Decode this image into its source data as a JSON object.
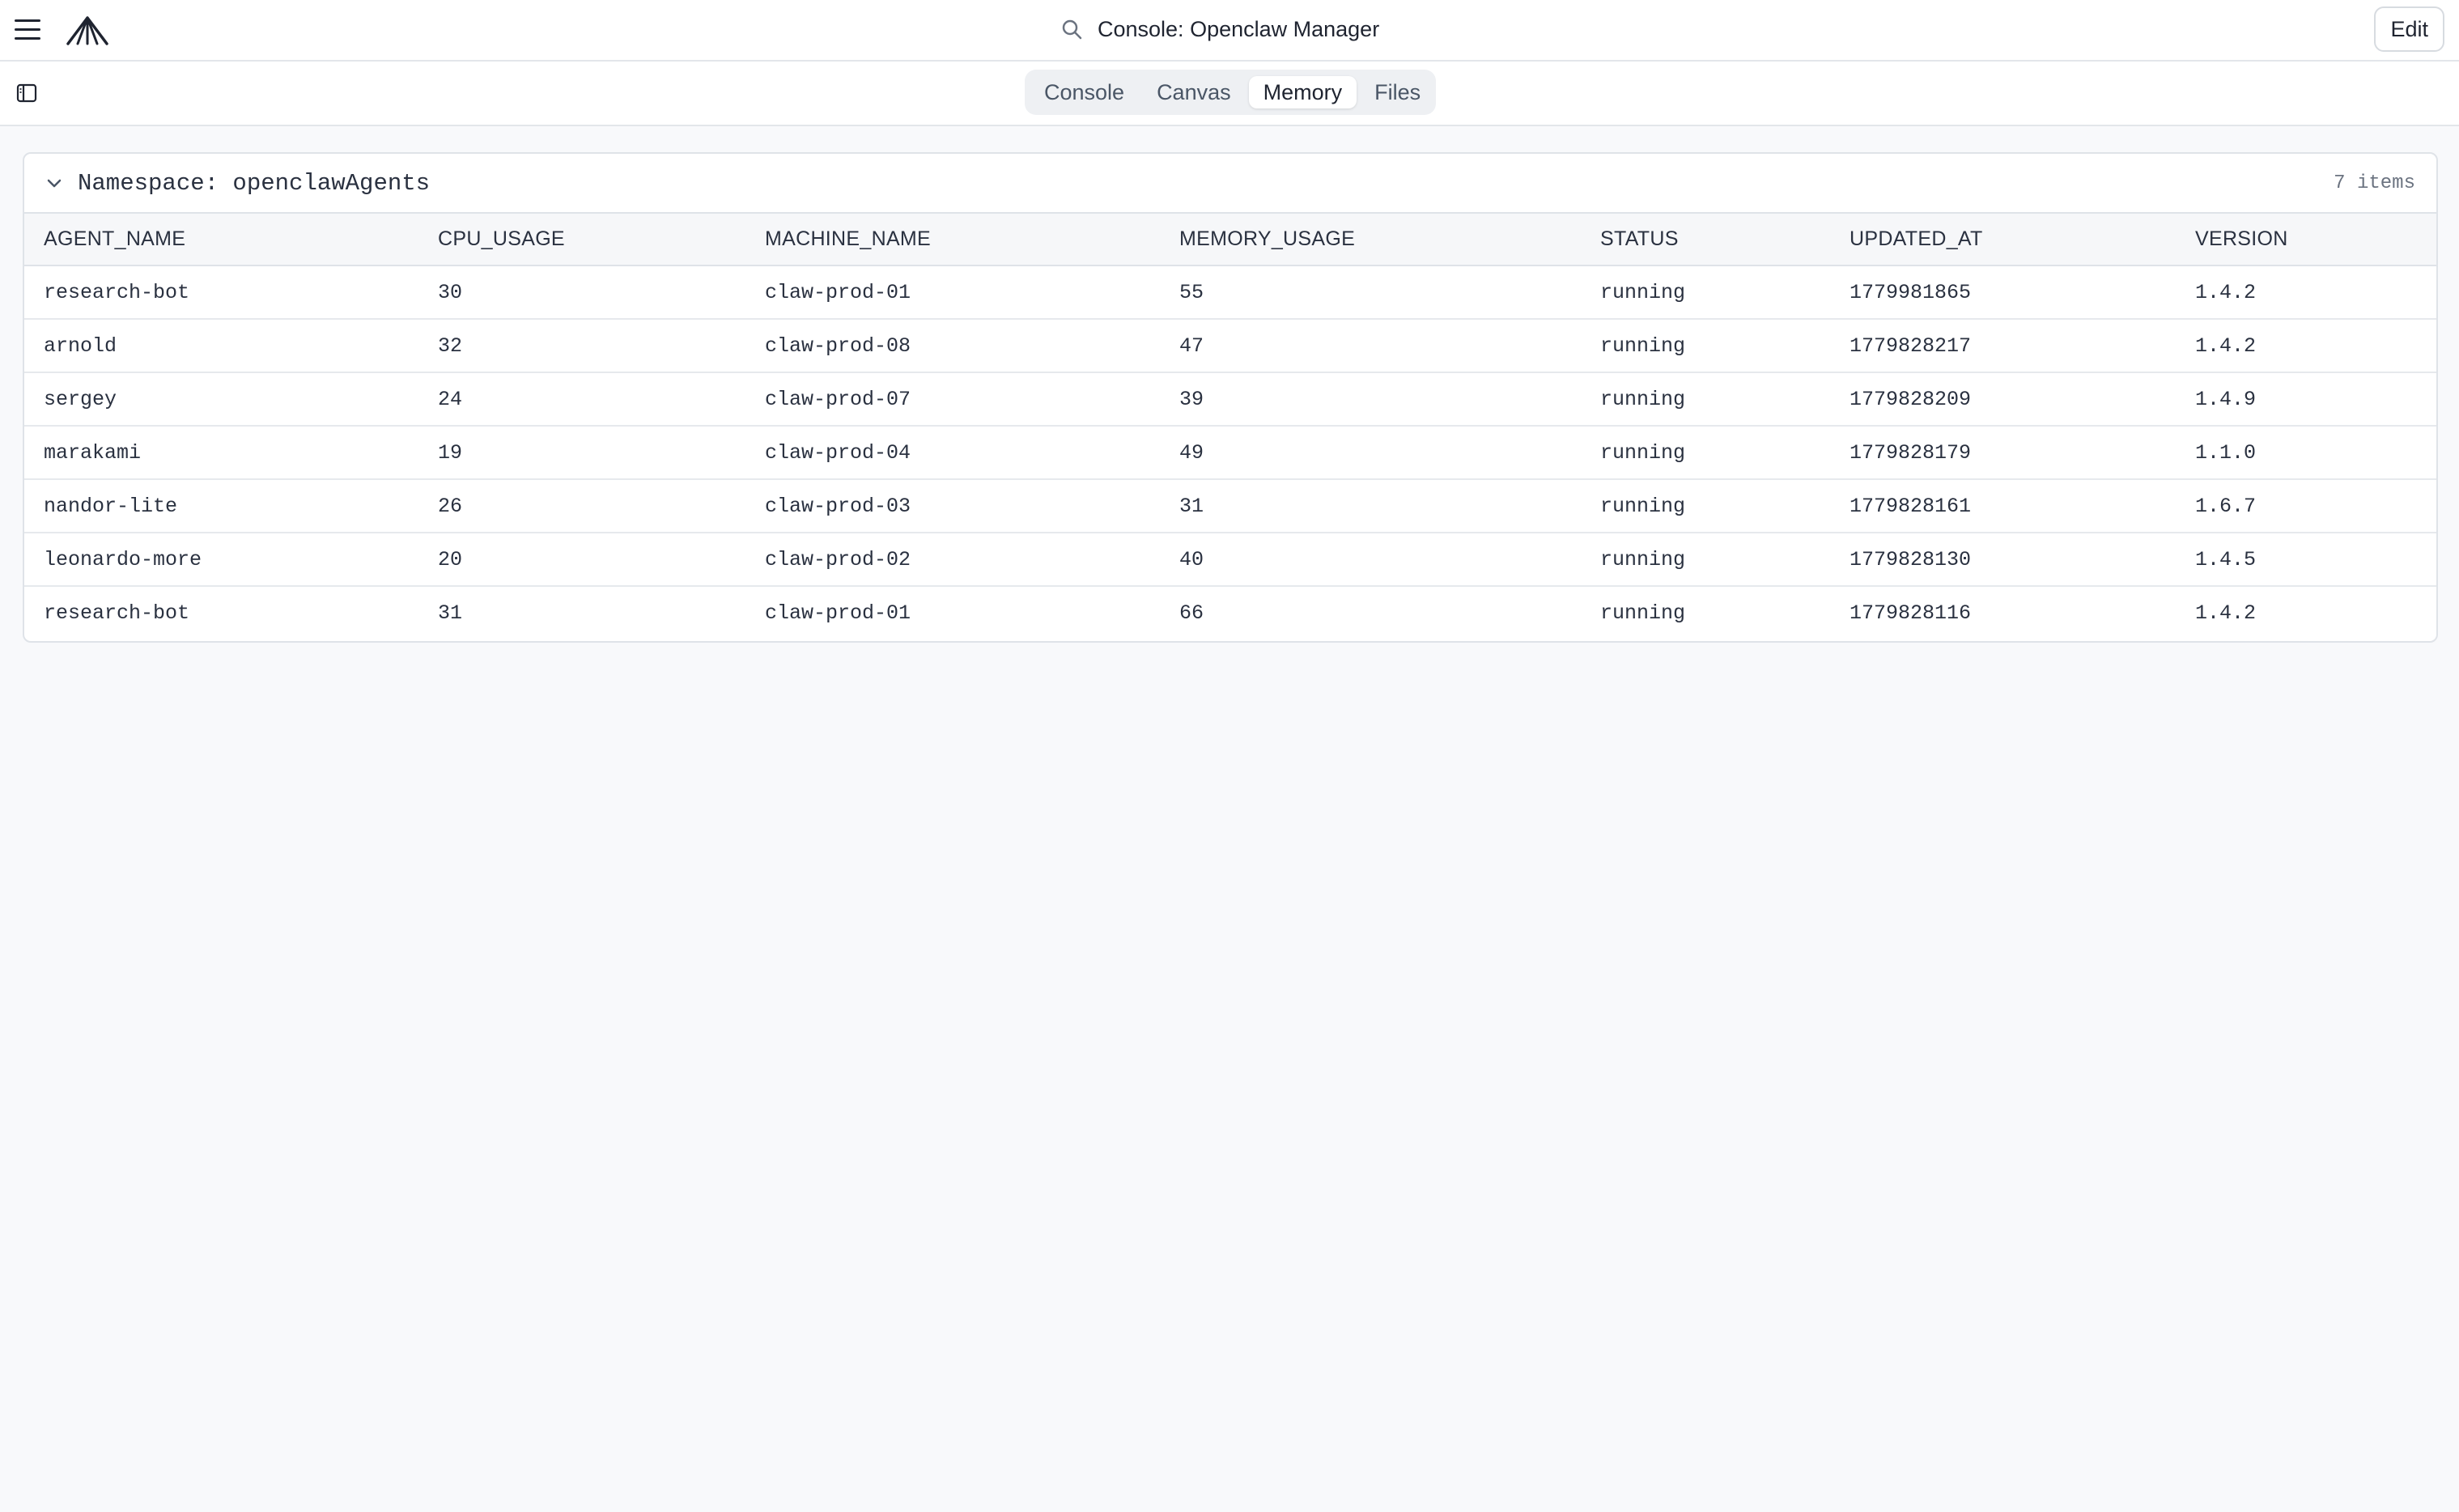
{
  "header": {
    "title": "Console: Openclaw Manager",
    "edit_label": "Edit"
  },
  "tabs": [
    {
      "label": "Console",
      "active": false
    },
    {
      "label": "Canvas",
      "active": false
    },
    {
      "label": "Memory",
      "active": true
    },
    {
      "label": "Files",
      "active": false
    }
  ],
  "namespace": {
    "title": "Namespace: openclawAgents",
    "count": "7 items",
    "columns": [
      "AGENT_NAME",
      "CPU_USAGE",
      "MACHINE_NAME",
      "MEMORY_USAGE",
      "STATUS",
      "UPDATED_AT",
      "VERSION"
    ],
    "rows": [
      [
        "research-bot",
        "30",
        "claw-prod-01",
        "55",
        "running",
        "1779981865",
        "1.4.2"
      ],
      [
        "arnold",
        "32",
        "claw-prod-08",
        "47",
        "running",
        "1779828217",
        "1.4.2"
      ],
      [
        "sergey",
        "24",
        "claw-prod-07",
        "39",
        "running",
        "1779828209",
        "1.4.9"
      ],
      [
        "marakami",
        "19",
        "claw-prod-04",
        "49",
        "running",
        "1779828179",
        "1.1.0"
      ],
      [
        "nandor-lite",
        "26",
        "claw-prod-03",
        "31",
        "running",
        "1779828161",
        "1.6.7"
      ],
      [
        "leonardo-more",
        "20",
        "claw-prod-02",
        "40",
        "running",
        "1779828130",
        "1.4.5"
      ],
      [
        "research-bot",
        "31",
        "claw-prod-01",
        "66",
        "running",
        "1779828116",
        "1.4.2"
      ]
    ]
  },
  "icons": {
    "menu": "hamburger-menu-icon",
    "logo": "openclaw-logo",
    "search": "search-icon",
    "panel": "sidebar-panel-icon",
    "collapse": "chevron-down-icon"
  }
}
